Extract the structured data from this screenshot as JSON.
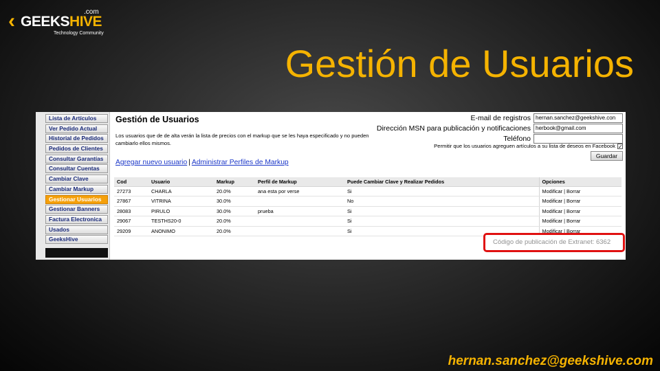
{
  "logo": {
    "name_part1": "GEEKS",
    "name_part2": "HIVE",
    "dotcom": ".com",
    "tagline": "Technology Community"
  },
  "slide_title": "Gestión de Usuarios",
  "sidebar": {
    "items": [
      {
        "label": "Lista de Artículos",
        "active": false
      },
      {
        "label": "Ver Pedido Actual",
        "active": false
      },
      {
        "label": "Historial de Pedidos",
        "active": false
      },
      {
        "label": "Pedidos de Clientes",
        "active": false
      },
      {
        "label": "Consultar Garantías",
        "active": false
      },
      {
        "label": "Consultar Cuentas",
        "active": false
      },
      {
        "label": "Cambiar Clave",
        "active": false
      },
      {
        "label": "Cambiar Markup",
        "active": false
      },
      {
        "label": "Gestionar Usuarios",
        "active": true
      },
      {
        "label": "Gestionar Banners",
        "active": false
      },
      {
        "label": "Factura Electronica",
        "active": false
      },
      {
        "label": "Usados",
        "active": false
      },
      {
        "label": "GeeksHive",
        "active": false
      }
    ]
  },
  "content": {
    "title": "Gestión de Usuarios",
    "description": "Los usuarios que de de alta verán la lista de precios con el markup que se les haya especificado y no pueden cambiarlo ellos mismos.",
    "link_add_user": "Agregar nuevo usuario",
    "link_separator": "|",
    "link_manage_profiles": "Administrar Perfiles de Markup"
  },
  "form": {
    "email_label": "E-mail de registros",
    "email_value": "hernan.sanchez@geekshive.con",
    "msn_label": "Dirección MSN para publicación y notificaciones",
    "msn_value": "herbook@gmail.com",
    "phone_label": "Teléfono",
    "phone_value": "",
    "facebook_label": "Permitir que los usuarios agreguen artículos a su lista de deseos en Facebook",
    "facebook_checked": true,
    "facebook_check_glyph": "✓",
    "save_label": "Guardar"
  },
  "table": {
    "headers": [
      "Cod",
      "Usuario",
      "Markup",
      "Perfil de Markup",
      "Puede Cambiar Clave y Realizar Pedidos",
      "Opciones"
    ],
    "rows": [
      [
        "27273",
        "CHARLA",
        "20.0%",
        "ana esta por verse",
        "Si",
        "Modificar | Borrar"
      ],
      [
        "27867",
        "VITRINA",
        "30.0%",
        "",
        "No",
        "Modificar | Borrar"
      ],
      [
        "28083",
        "PIRULO",
        "30.0%",
        "prueba",
        "Si",
        "Modificar | Borrar"
      ],
      [
        "29067",
        "TESTHS20-0",
        "20.0%",
        "",
        "Si",
        "Modificar | Borrar"
      ],
      [
        "29209",
        "ANONIMO",
        "20.0%",
        "",
        "Si",
        "Modificar | Borrar"
      ]
    ]
  },
  "extranet_code": "Código de publicación de Extranet: 6362",
  "footer_email": "hernan.sanchez@geekshive.com",
  "colors": {
    "accent": "#f5b301",
    "active_tab": "#f5a00a",
    "highlight_border": "#e01010",
    "link": "#1a36c8"
  }
}
